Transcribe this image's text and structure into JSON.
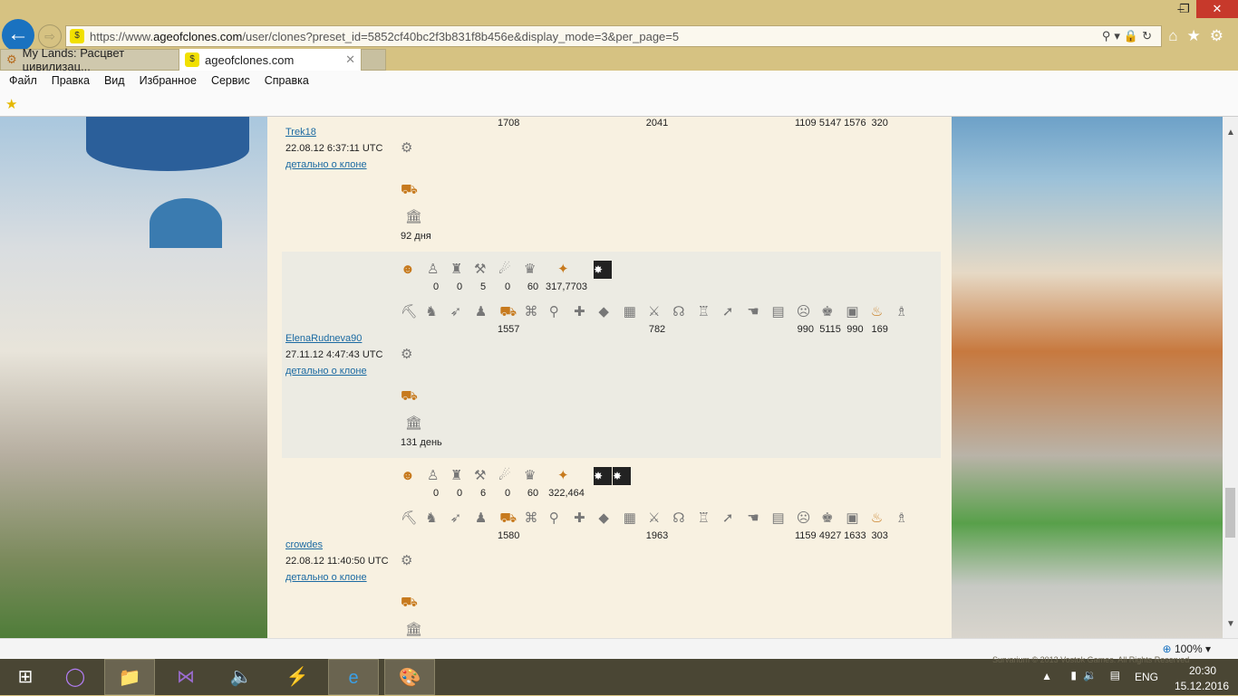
{
  "browser": {
    "url_prefix": "https://www.",
    "url_domain": "ageofclones.com",
    "url_path": "/user/clones?preset_id=5852cf40bc2f3b831f8b456e&display_mode=3&per_page=5",
    "tabs": [
      {
        "label": "My Lands: Расцвет цивилизац..."
      },
      {
        "label": "ageofclones.com"
      }
    ],
    "menu": [
      "Файл",
      "Правка",
      "Вид",
      "Избранное",
      "Сервис",
      "Справка"
    ],
    "zoom": "100%"
  },
  "row1_icons": [
    "avatar-icon",
    "clone-icon",
    "warrior-icon",
    "axe-icon",
    "cannon-icon",
    "mage-icon",
    "gold-icon",
    "badge-icon",
    "badge-icon"
  ],
  "row2_icons": [
    "worker-icon",
    "runner-icon",
    "archer-icon",
    "scout-icon",
    "cart-icon",
    "net-icon",
    "magnifier-icon",
    "medic-icon",
    "shield-icon",
    "wall-icon",
    "swords-icon",
    "horn-icon",
    "builder-icon",
    "spear-icon",
    "hand-icon",
    "scroll-icon",
    "bandit-icon",
    "wrestler-icon",
    "prayer-icon",
    "monk-icon",
    "statue-icon"
  ],
  "clones": [
    {
      "name": "Trek18",
      "date": "22.08.12 6:37:11 UTC",
      "detail": "детально о клоне",
      "days": "92 дня",
      "row1": [],
      "badges": 0,
      "row2": [
        "",
        "",
        "",
        "",
        "1708",
        "",
        "",
        "",
        "",
        "",
        "2041",
        "",
        "",
        "",
        "",
        "",
        "1109",
        "5147",
        "1576",
        "320",
        ""
      ],
      "highlight": false
    },
    {
      "name": "ElenaRudneva90",
      "date": "27.11.12 4:47:43 UTC",
      "detail": "детально о клоне",
      "days": "131 день",
      "row1": [
        "",
        "0",
        "0",
        "5",
        "0",
        "60",
        "317,7703"
      ],
      "badges": 1,
      "row2": [
        "",
        "",
        "",
        "",
        "1557",
        "",
        "",
        "",
        "",
        "",
        "782",
        "",
        "",
        "",
        "",
        "",
        "990",
        "5115",
        "990",
        "169",
        ""
      ],
      "highlight": true
    },
    {
      "name": "crowdes",
      "date": "22.08.12 11:40:50 UTC",
      "detail": "детально о клоне",
      "days": "",
      "row1": [
        "",
        "0",
        "0",
        "6",
        "0",
        "60",
        "322,464"
      ],
      "badges": 2,
      "row2": [
        "",
        "",
        "",
        "",
        "1580",
        "",
        "",
        "",
        "",
        "",
        "1963",
        "",
        "",
        "",
        "",
        "",
        "1159",
        "4927",
        "1633",
        "303",
        ""
      ],
      "highlight": false
    }
  ],
  "footer": {
    "copyright": "Survarium © 2013 Vostok Games. All Rights Reserved"
  },
  "tray": {
    "lang": "ENG",
    "time": "20:30",
    "date": "15.12.2016"
  }
}
